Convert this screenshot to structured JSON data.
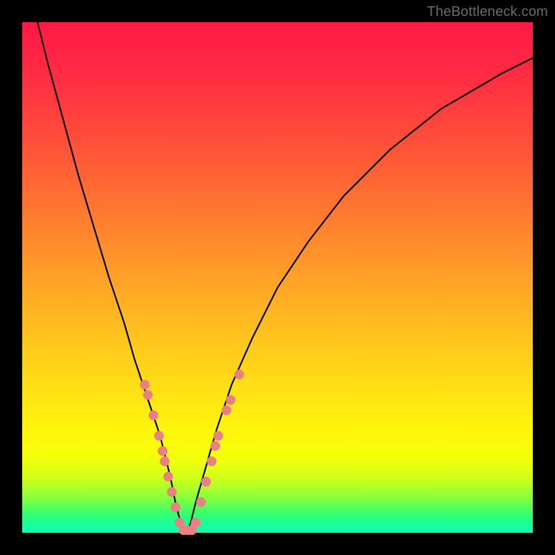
{
  "watermark": "TheBottleneck.com",
  "chart_data": {
    "type": "line",
    "title": "",
    "xlabel": "",
    "ylabel": "",
    "xlim": [
      0,
      100
    ],
    "ylim": [
      0,
      100
    ],
    "series": [
      {
        "name": "bottleneck-curve",
        "x": [
          3,
          5,
          8,
          11,
          14,
          17,
          20,
          22,
          24,
          26,
          27,
          28,
          29,
          30,
          31,
          32,
          33,
          34,
          36,
          38,
          41,
          45,
          50,
          56,
          63,
          72,
          82,
          94,
          100
        ],
        "y": [
          100,
          92,
          81,
          70,
          60,
          50,
          41,
          34,
          28,
          22,
          19,
          15,
          11,
          6,
          2,
          0,
          2,
          6,
          13,
          20,
          29,
          38,
          48,
          57,
          66,
          75,
          83,
          90,
          93
        ]
      }
    ],
    "markers": {
      "name": "highlight-dots",
      "color": "#e98181",
      "points": [
        {
          "x": 24.0,
          "y": 29
        },
        {
          "x": 24.6,
          "y": 27
        },
        {
          "x": 25.7,
          "y": 23
        },
        {
          "x": 26.8,
          "y": 19
        },
        {
          "x": 27.5,
          "y": 16
        },
        {
          "x": 27.9,
          "y": 14
        },
        {
          "x": 28.6,
          "y": 11
        },
        {
          "x": 29.3,
          "y": 8
        },
        {
          "x": 30.0,
          "y": 5
        },
        {
          "x": 30.8,
          "y": 2
        },
        {
          "x": 31.6,
          "y": 0.5
        },
        {
          "x": 32.4,
          "y": 0.5
        },
        {
          "x": 33.2,
          "y": 0.5
        },
        {
          "x": 34.0,
          "y": 2
        },
        {
          "x": 35.0,
          "y": 6
        },
        {
          "x": 36.0,
          "y": 10
        },
        {
          "x": 37.1,
          "y": 14
        },
        {
          "x": 37.8,
          "y": 17
        },
        {
          "x": 38.4,
          "y": 19
        },
        {
          "x": 40.0,
          "y": 24
        },
        {
          "x": 40.8,
          "y": 26
        },
        {
          "x": 42.5,
          "y": 31
        }
      ]
    }
  }
}
